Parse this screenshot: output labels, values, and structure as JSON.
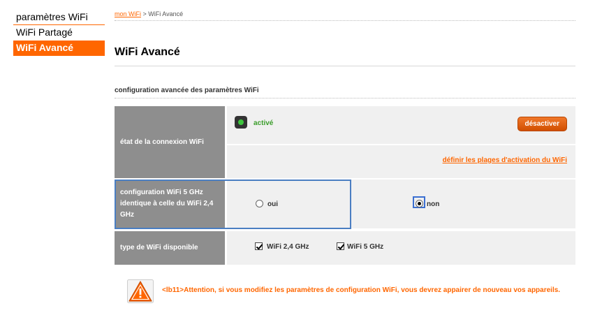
{
  "sidebar": {
    "items": [
      {
        "label": "paramètres WiFi"
      },
      {
        "label": "WiFi Partagé"
      },
      {
        "label": "WiFi Avancé"
      }
    ]
  },
  "breadcrumb": {
    "home_link": "mon WiFi",
    "separator": ">",
    "current": "WiFi Avancé"
  },
  "page": {
    "title": "WiFi Avancé",
    "section_title": "configuration avancée des paramètres WiFi"
  },
  "connection": {
    "label": "état de la connexion WiFi",
    "status": "activé",
    "deactivate_button": "désactiver",
    "schedule_link": "définir les plages d'activation du WiFi"
  },
  "config5g": {
    "label": "configuration WiFi 5 GHz identique à celle du WiFi 2,4 GHz",
    "options": [
      {
        "label": "oui",
        "selected": false
      },
      {
        "label": "non",
        "selected": true
      }
    ]
  },
  "wifi_types": {
    "label": "type de WiFi disponible",
    "options": [
      {
        "label": "WiFi 2,4 GHz",
        "checked": true
      },
      {
        "label": "WiFi 5 GHz",
        "checked": true
      }
    ]
  },
  "warning": {
    "text": "<lb11>Attention, si vous modifiez les paramètres de configuration WiFi, vous devrez appairer de nouveau vos appareils."
  },
  "colors": {
    "accent": "#ff6600",
    "label_bg": "#8e8e8e",
    "value_bg": "#f0f0f0",
    "status_green": "#3a9d2a",
    "focus_blue": "#4a7ec2"
  }
}
